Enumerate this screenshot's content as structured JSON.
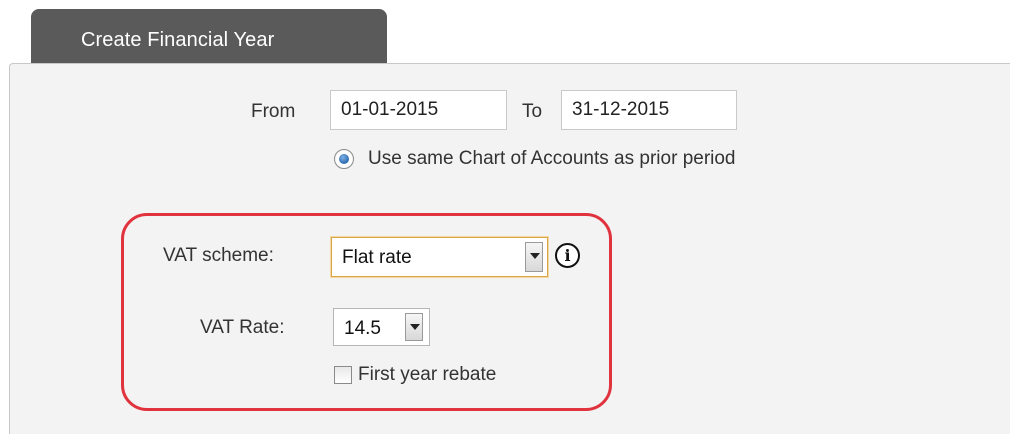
{
  "tab": {
    "title": "Create Financial Year"
  },
  "period": {
    "from_label": "From",
    "from_value": "01-01-2015",
    "to_label": "To",
    "to_value": "31-12-2015"
  },
  "chart_option": {
    "label": "Use same Chart of Accounts as prior period",
    "selected": true
  },
  "vat": {
    "scheme_label": "VAT scheme:",
    "scheme_value": "Flat rate",
    "rate_label": "VAT Rate:",
    "rate_value": "14.5",
    "rebate_label": "First year rebate",
    "rebate_checked": false,
    "info_glyph": "i",
    "highlight_color": "#e0333d"
  },
  "icons": {
    "info": "info-icon",
    "dropdown": "chevron-down-icon",
    "radio": "radio-selected-icon",
    "checkbox": "checkbox-unchecked-icon"
  }
}
